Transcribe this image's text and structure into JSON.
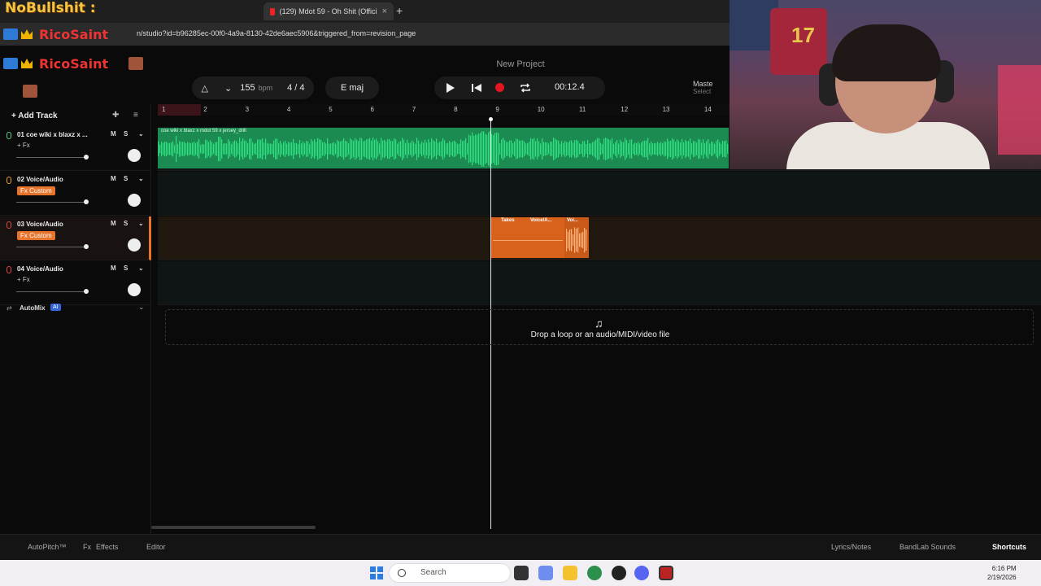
{
  "browser": {
    "overlay_title": "NoBullshit :",
    "tabs": [
      {
        "label": "(129) Mdot 59 - Oh Shit (Offici",
        "close": "×"
      }
    ],
    "new_tab": "+",
    "url": "n/studio?id=b96285ec-00f0-4a9a-8130-42de6aec5906&triggered_from=revision_page",
    "overlay_name_1": "RicoSaint",
    "overlay_name_2": "RicoSaint"
  },
  "app": {
    "project_title": "New Project",
    "toolbar": {
      "bpm_value": "155",
      "bpm_unit": "bpm",
      "time_signature": "4 / 4",
      "key": "E maj",
      "time": "00:12.4",
      "master_label": "Maste",
      "master_sub": "Select"
    },
    "add_track_label": "Add Track",
    "tracks": [
      {
        "name": "01 coe wiki x blaxz x ...",
        "mute": "M",
        "solo": "S",
        "fx": "+ Fx",
        "fx_custom": false
      },
      {
        "name": "02 Voice/Audio",
        "mute": "M",
        "solo": "S",
        "fx": "Fx Custom",
        "fx_custom": true
      },
      {
        "name": "03 Voice/Audio",
        "mute": "M",
        "solo": "S",
        "fx": "Fx Custom",
        "fx_custom": true
      },
      {
        "name": "04 Voice/Audio",
        "mute": "M",
        "solo": "S",
        "fx": "+ Fx",
        "fx_custom": false
      }
    ],
    "automix_label": "AutoMix",
    "automix_badge": "AI",
    "ruler_numbers": [
      "1",
      "2",
      "3",
      "4",
      "5",
      "6",
      "7",
      "8",
      "9",
      "10",
      "11",
      "12",
      "13",
      "14"
    ],
    "clips": {
      "green_label": "coe wiki x blaxz x mdot 59 x jersey_drill",
      "orange_takes": "Takes",
      "orange_label_2": "Voice/A...",
      "orange_label_3": "Voi..."
    },
    "dropzone_text": "Drop a loop or an audio/MIDI/video file",
    "bottombar": {
      "autopitch": "AutoPitch™",
      "effects": "Effects",
      "editor": "Editor",
      "lyrics": "Lyrics/Notes",
      "sounds": "BandLab Sounds",
      "shortcuts": "Shortcuts"
    }
  },
  "webcam": {
    "jersey_number": "17"
  },
  "taskbar": {
    "search_label": "Search",
    "time": "6:16 PM",
    "date": "2/19/2026"
  },
  "colors": {
    "accent_orange": "#e8732a",
    "clip_green": "#1c8b52",
    "record_red": "#e3161f"
  }
}
